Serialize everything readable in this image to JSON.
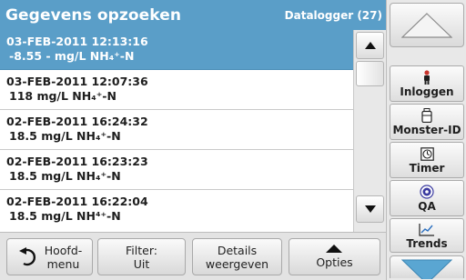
{
  "header": {
    "title": "Gegevens opzoeken",
    "subtitle": "Datalogger (27)"
  },
  "rows": [
    {
      "datetime": "03-FEB-2011  12:13:16",
      "value": "-8.55  -  mg/L  NH₄⁺-N",
      "selected": true
    },
    {
      "datetime": "03-FEB-2011  12:07:36",
      "value": "118  mg/L  NH₄⁺-N",
      "selected": false
    },
    {
      "datetime": "02-FEB-2011  16:24:32",
      "value": "18.5  mg/L  NH₄⁺-N",
      "selected": false
    },
    {
      "datetime": "02-FEB-2011  16:23:23",
      "value": "18.5  mg/L  NH₄⁺-N",
      "selected": false
    },
    {
      "datetime": "02-FEB-2011  16:22:04",
      "value": "18.5  mg/L  NH⁴⁺-N",
      "selected": false
    }
  ],
  "bottom": {
    "home": {
      "line1": "Hoofd-",
      "line2": "menu"
    },
    "filter": {
      "line1": "Filter:",
      "line2": "Uit"
    },
    "details": {
      "line1": "Details",
      "line2": "weergeven"
    },
    "options": {
      "label": "Opties"
    }
  },
  "side": {
    "login": "Inloggen",
    "sample_id": "Monster-ID",
    "timer": "Timer",
    "qa": "QA",
    "trends": "Trends"
  },
  "colors": {
    "accent": "#5a9ec8",
    "arrow": "#5aa6d2"
  }
}
